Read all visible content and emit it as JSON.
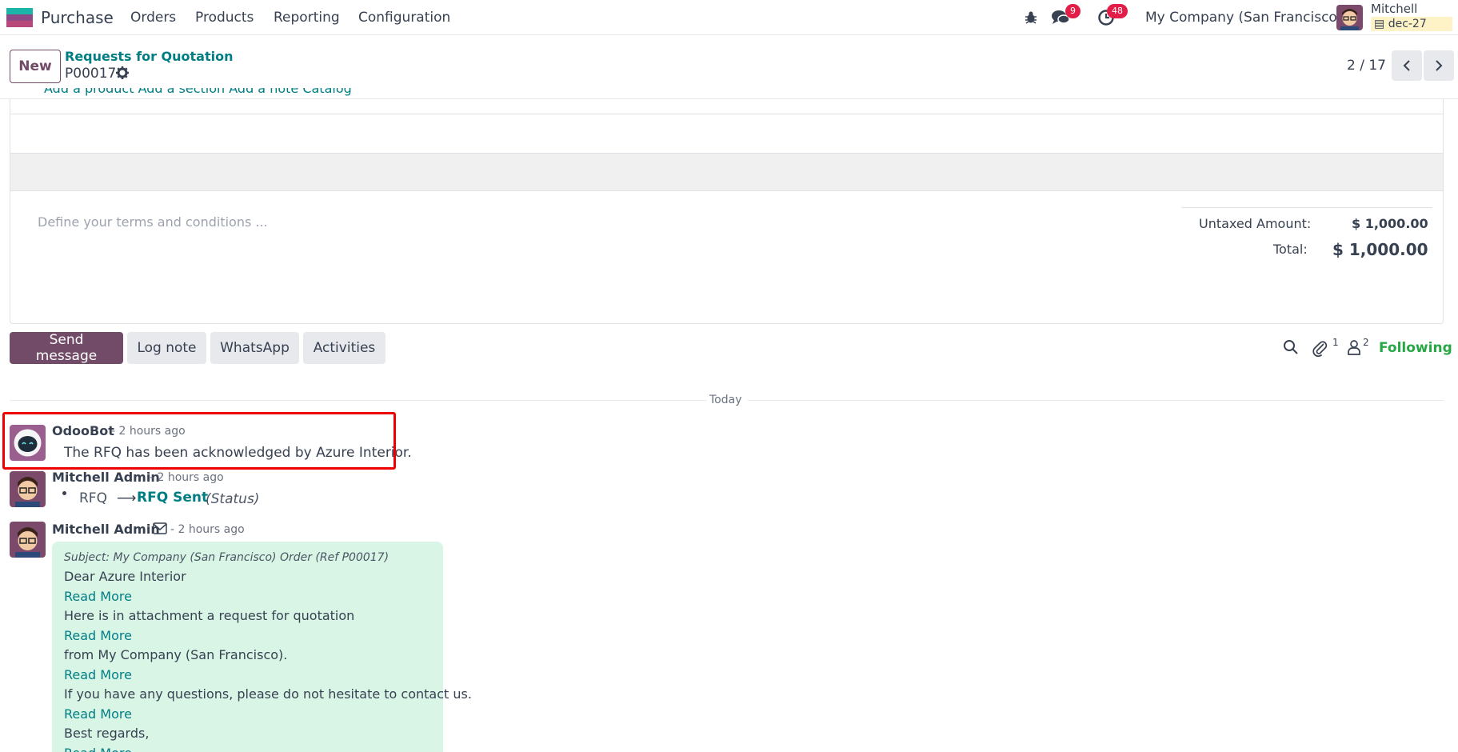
{
  "app": {
    "name": "Purchase"
  },
  "menu": [
    "Orders",
    "Products",
    "Reporting",
    "Configuration"
  ],
  "systray": {
    "messages_count": "9",
    "activities_count": "48",
    "company": "My Company (San Francisco)",
    "user": "Mitchell Admin",
    "database": "dec-27"
  },
  "control": {
    "new_label": "New",
    "breadcrumb": "Requests for Quotation",
    "record": "P00017",
    "pager": "2 / 17"
  },
  "form": {
    "cut_links": "Add a product    Add a section    Add a note    Catalog",
    "terms_placeholder": "Define your terms and conditions ...",
    "untaxed_label": "Untaxed Amount:",
    "untaxed_value": "$ 1,000.00",
    "total_label": "Total:",
    "total_value": "$ 1,000.00"
  },
  "chatter": {
    "send_message": "Send message",
    "log_note": "Log note",
    "whatsapp": "WhatsApp",
    "activities": "Activities",
    "attachments_count": "1",
    "followers_count": "2",
    "following": "Following",
    "date_separator": "Today"
  },
  "messages": [
    {
      "author": "OdooBot",
      "ago": "- 2 hours ago",
      "text": "The RFQ has been acknowledged by Azure Interior."
    },
    {
      "author": "Mitchell Admin",
      "ago": "- 2 hours ago",
      "old_value": "RFQ",
      "arrow": "⟶",
      "new_value": "RFQ Sent",
      "field": "(Status)"
    },
    {
      "author": "Mitchell Admin",
      "ago": "- 2 hours ago",
      "subject": "Subject: My Company (San Francisco) Order (Ref P00017)",
      "lines": [
        "Dear Azure Interior",
        "Here is in attachment a request for quotation",
        "from My Company (San Francisco).",
        "If you have any questions, please do not hesitate to contact us.",
        "Best regards,"
      ],
      "read_more": "Read More"
    }
  ],
  "colors": {
    "brand": "#714b67",
    "link": "#017e84",
    "following": "#28a745",
    "badge": "#e11d48",
    "highlight": "#ee0000",
    "email_bg": "#d9f5e6"
  }
}
